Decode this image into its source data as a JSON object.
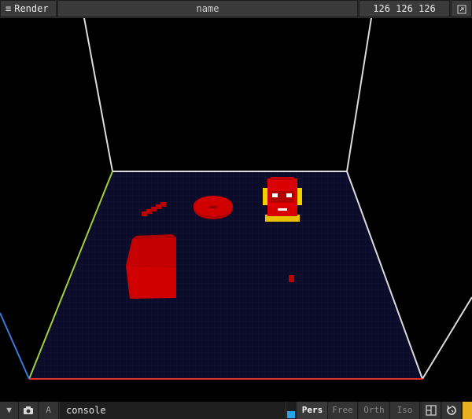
{
  "topbar": {
    "render_label": "Render",
    "name_value": "name",
    "size_value": "126 126 126"
  },
  "bottombar": {
    "a_label": "A",
    "console_value": "console",
    "modes": [
      "Pers",
      "Free",
      "Orth",
      "Iso"
    ],
    "active_mode": "Pers"
  },
  "icons": {
    "menu": "menu-icon",
    "expand": "expand-icon",
    "dropdown": "triangle-down-icon",
    "camera": "camera-icon",
    "layout": "layout-icon",
    "reset": "reset-view-icon"
  },
  "colors": {
    "background": "#000000",
    "floor": "#0c0c2a",
    "voxel": "#c80000",
    "axis_x": "#e03030",
    "axis_y": "#3a7ad8",
    "axis_z": "#a0d040",
    "accent_blue": "#29a3ee",
    "accent_yellow": "#e8b020"
  }
}
